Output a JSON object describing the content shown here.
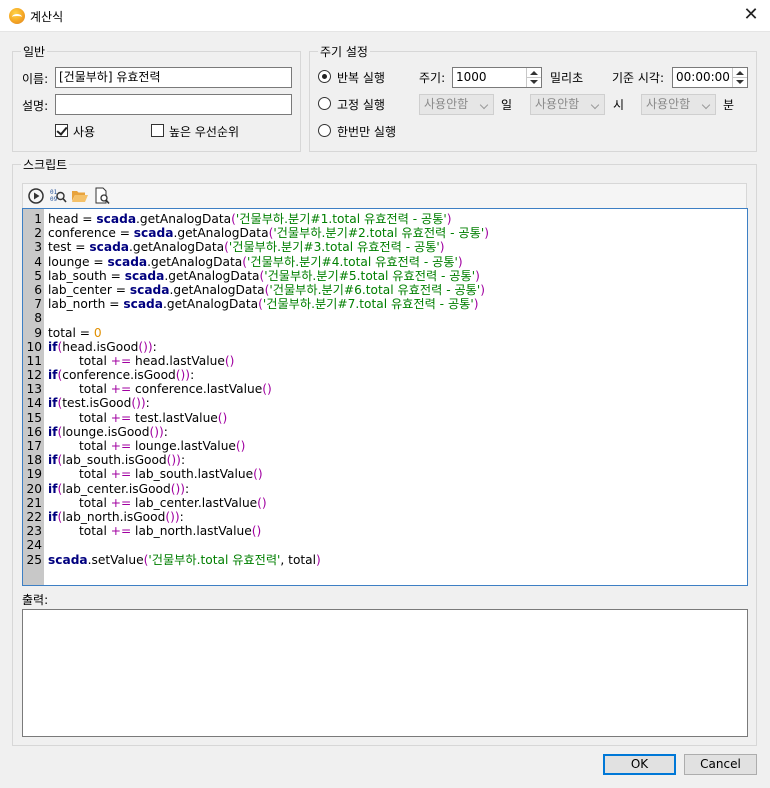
{
  "window": {
    "title": "계산식"
  },
  "general": {
    "legend": "일반",
    "name_label": "이름:",
    "name_value": "[건물부하] 유효전력",
    "desc_label": "설명:",
    "desc_value": "",
    "use_label": "사용",
    "use_checked": true,
    "priority_label": "높은 우선순위",
    "priority_checked": false
  },
  "cycle": {
    "legend": "주기 설정",
    "repeat_label": "반복 실행",
    "fixed_label": "고정 실행",
    "once_label": "한번만 실행",
    "selected": "repeat",
    "period_label": "주기:",
    "period_value": "1000",
    "period_unit": "밀리초",
    "base_time_label": "기준 시각:",
    "base_time_value": "00:00:00",
    "combo_value": "사용안함",
    "day_label": "일",
    "hour_label": "시",
    "minute_label": "분"
  },
  "script": {
    "legend": "스크립트",
    "toolbar_icons": [
      "run-icon",
      "debug-icon",
      "open-folder-icon",
      "preview-icon"
    ],
    "lines": [
      [
        {
          "t": "head = "
        },
        {
          "k": "kw",
          "t": "scada"
        },
        {
          "t": ".getAnalogData"
        },
        {
          "k": "par",
          "t": "("
        },
        {
          "k": "str",
          "t": "'건물부하.분기#1.total 유효전력 - 공통'"
        },
        {
          "k": "par",
          "t": ")"
        }
      ],
      [
        {
          "t": "conference = "
        },
        {
          "k": "kw",
          "t": "scada"
        },
        {
          "t": ".getAnalogData"
        },
        {
          "k": "par",
          "t": "("
        },
        {
          "k": "str",
          "t": "'건물부하.분기#2.total 유효전력 - 공통'"
        },
        {
          "k": "par",
          "t": ")"
        }
      ],
      [
        {
          "t": "test = "
        },
        {
          "k": "kw",
          "t": "scada"
        },
        {
          "t": ".getAnalogData"
        },
        {
          "k": "par",
          "t": "("
        },
        {
          "k": "str",
          "t": "'건물부하.분기#3.total 유효전력 - 공통'"
        },
        {
          "k": "par",
          "t": ")"
        }
      ],
      [
        {
          "t": "lounge = "
        },
        {
          "k": "kw",
          "t": "scada"
        },
        {
          "t": ".getAnalogData"
        },
        {
          "k": "par",
          "t": "("
        },
        {
          "k": "str",
          "t": "'건물부하.분기#4.total 유효전력 - 공통'"
        },
        {
          "k": "par",
          "t": ")"
        }
      ],
      [
        {
          "t": "lab_south = "
        },
        {
          "k": "kw",
          "t": "scada"
        },
        {
          "t": ".getAnalogData"
        },
        {
          "k": "par",
          "t": "("
        },
        {
          "k": "str",
          "t": "'건물부하.분기#5.total 유효전력 - 공통'"
        },
        {
          "k": "par",
          "t": ")"
        }
      ],
      [
        {
          "t": "lab_center = "
        },
        {
          "k": "kw",
          "t": "scada"
        },
        {
          "t": ".getAnalogData"
        },
        {
          "k": "par",
          "t": "("
        },
        {
          "k": "str",
          "t": "'건물부하.분기#6.total 유효전력 - 공통'"
        },
        {
          "k": "par",
          "t": ")"
        }
      ],
      [
        {
          "t": "lab_north = "
        },
        {
          "k": "kw",
          "t": "scada"
        },
        {
          "t": ".getAnalogData"
        },
        {
          "k": "par",
          "t": "("
        },
        {
          "k": "str",
          "t": "'건물부하.분기#7.total 유효전력 - 공통'"
        },
        {
          "k": "par",
          "t": ")"
        }
      ],
      [],
      [
        {
          "t": "total = "
        },
        {
          "k": "num",
          "t": "0"
        }
      ],
      [
        {
          "k": "kw",
          "t": "if"
        },
        {
          "k": "par",
          "t": "("
        },
        {
          "t": "head.isGood"
        },
        {
          "k": "par",
          "t": "())"
        },
        {
          "t": ":"
        }
      ],
      [
        {
          "t": "        total "
        },
        {
          "k": "par",
          "t": "+="
        },
        {
          "t": " head.lastValue"
        },
        {
          "k": "par",
          "t": "()"
        }
      ],
      [
        {
          "k": "kw",
          "t": "if"
        },
        {
          "k": "par",
          "t": "("
        },
        {
          "t": "conference.isGood"
        },
        {
          "k": "par",
          "t": "())"
        },
        {
          "t": ":"
        }
      ],
      [
        {
          "t": "        total "
        },
        {
          "k": "par",
          "t": "+="
        },
        {
          "t": " conference.lastValue"
        },
        {
          "k": "par",
          "t": "()"
        }
      ],
      [
        {
          "k": "kw",
          "t": "if"
        },
        {
          "k": "par",
          "t": "("
        },
        {
          "t": "test.isGood"
        },
        {
          "k": "par",
          "t": "())"
        },
        {
          "t": ":"
        }
      ],
      [
        {
          "t": "        total "
        },
        {
          "k": "par",
          "t": "+="
        },
        {
          "t": " test.lastValue"
        },
        {
          "k": "par",
          "t": "()"
        }
      ],
      [
        {
          "k": "kw",
          "t": "if"
        },
        {
          "k": "par",
          "t": "("
        },
        {
          "t": "lounge.isGood"
        },
        {
          "k": "par",
          "t": "())"
        },
        {
          "t": ":"
        }
      ],
      [
        {
          "t": "        total "
        },
        {
          "k": "par",
          "t": "+="
        },
        {
          "t": " lounge.lastValue"
        },
        {
          "k": "par",
          "t": "()"
        }
      ],
      [
        {
          "k": "kw",
          "t": "if"
        },
        {
          "k": "par",
          "t": "("
        },
        {
          "t": "lab_south.isGood"
        },
        {
          "k": "par",
          "t": "())"
        },
        {
          "t": ":"
        }
      ],
      [
        {
          "t": "        total "
        },
        {
          "k": "par",
          "t": "+="
        },
        {
          "t": " lab_south.lastValue"
        },
        {
          "k": "par",
          "t": "()"
        }
      ],
      [
        {
          "k": "kw",
          "t": "if"
        },
        {
          "k": "par",
          "t": "("
        },
        {
          "t": "lab_center.isGood"
        },
        {
          "k": "par",
          "t": "())"
        },
        {
          "t": ":"
        }
      ],
      [
        {
          "t": "        total "
        },
        {
          "k": "par",
          "t": "+="
        },
        {
          "t": " lab_center.lastValue"
        },
        {
          "k": "par",
          "t": "()"
        }
      ],
      [
        {
          "k": "kw",
          "t": "if"
        },
        {
          "k": "par",
          "t": "("
        },
        {
          "t": "lab_north.isGood"
        },
        {
          "k": "par",
          "t": "())"
        },
        {
          "t": ":"
        }
      ],
      [
        {
          "t": "        total "
        },
        {
          "k": "par",
          "t": "+="
        },
        {
          "t": " lab_north.lastValue"
        },
        {
          "k": "par",
          "t": "()"
        }
      ],
      [],
      [
        {
          "k": "kw",
          "t": "scada"
        },
        {
          "t": ".setValue"
        },
        {
          "k": "par",
          "t": "("
        },
        {
          "k": "str",
          "t": "'건물부하.total 유효전력'"
        },
        {
          "t": ", total"
        },
        {
          "k": "par",
          "t": ")"
        }
      ]
    ]
  },
  "output": {
    "label": "출력:",
    "text": ""
  },
  "buttons": {
    "ok": "OK",
    "cancel": "Cancel"
  }
}
